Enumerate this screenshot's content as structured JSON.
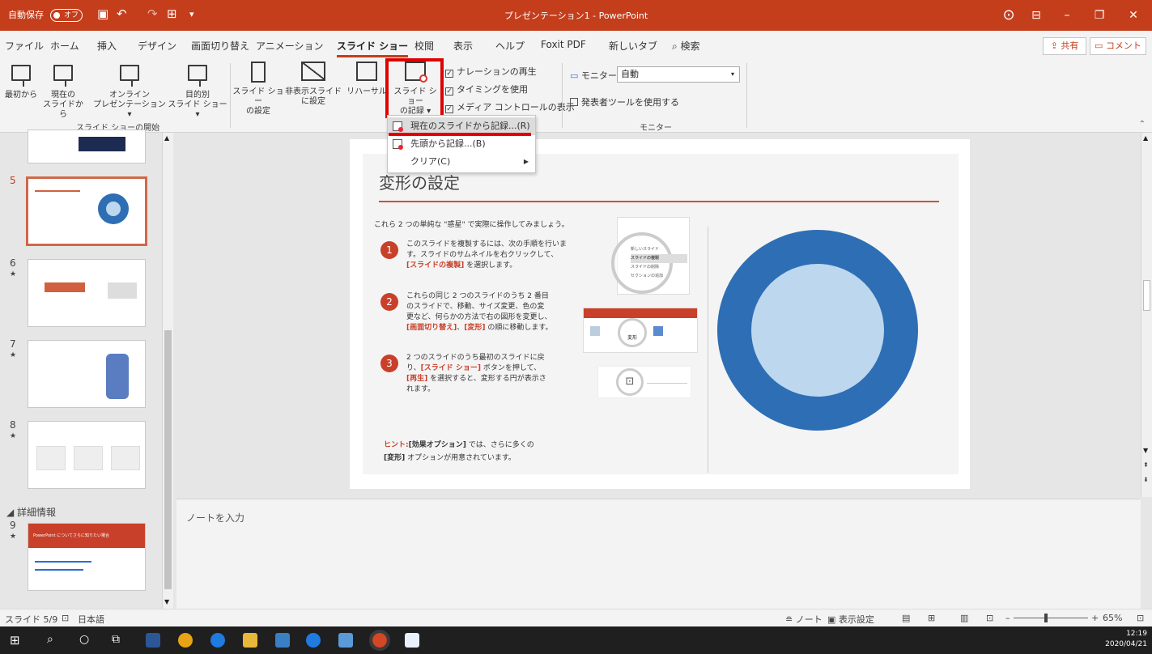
{
  "titlebar": {
    "autosave_label": "自動保存",
    "autosave_state": "オフ",
    "window_title": "プレゼンテーション1 - PowerPoint",
    "bg_color": "#c43e1c"
  },
  "menu": {
    "tabs": [
      "ファイル",
      "ホーム",
      "挿入",
      "デザイン",
      "画面切り替え",
      "アニメーション",
      "スライド ショー",
      "校閲",
      "表示",
      "ヘルプ",
      "Foxit PDF",
      "新しいタブ"
    ],
    "active_tab": "スライド ショー",
    "search": "検索",
    "share": "共有",
    "comment": "コメント"
  },
  "ribbon": {
    "from_start": "最初から",
    "from_current_1": "現在の",
    "from_current_2": "スライドから",
    "online_1": "オンライン",
    "online_2": "プレゼンテーション ▾",
    "custom_1": "目的別",
    "custom_2": "スライド ショー ▾",
    "group_start": "スライド ショーの開始",
    "setup_1": "スライド ショー",
    "setup_2": "の設定",
    "hide_1": "非表示スライド",
    "hide_2": "に設定",
    "rehearse": "リハーサル",
    "record_1": "スライド ショー",
    "record_2": "の記録 ▾",
    "play_narration": "ナレーションの再生",
    "use_timings": "タイミングを使用",
    "media_controls": "メディア コントロールの表示",
    "monitor_label": "モニター:",
    "monitor_value": "自動",
    "presenter_view": "発表者ツールを使用する",
    "group_monitor": "モニター"
  },
  "dropdown": {
    "items": [
      "現在のスライドから記録...(R)",
      "先頭から記録...(B)",
      "クリア(C)"
    ]
  },
  "thumbnails": {
    "numbers": [
      "5",
      "6",
      "7",
      "8",
      "9"
    ],
    "star": "★",
    "section": "詳細情報",
    "slide9_title": "PowerPoint についてさらに知りたい場合"
  },
  "slide": {
    "title": "変形の設定",
    "intro": "これら 2 つの単純な \"惑星\" で実際に操作してみましょう。",
    "step1_a": "このスライドを複製するには、次の手順を行いま",
    "step1_b": "す。スライドのサムネイルを右クリックして、",
    "step1_c_hi": "[スライドの複製]",
    "step1_c": " を選択します。",
    "step2_a": "これらの同じ 2 つのスライドのうち 2 番目",
    "step2_b": "のスライドで、移動、サイズ変更、色の変",
    "step2_c": "更など、何らかの方法で右の図形を変更し、",
    "step2_d_hi1": "[画面切り替え]",
    "step2_d_mid": "、",
    "step2_d_hi2": "[変形]",
    "step2_d": " の順に移動します。",
    "step3_a": "2 つのスライドのうち最初のスライドに戻",
    "step3_b1": "り、",
    "step3_b_hi": "[スライド ショー]",
    "step3_b2": " ボタンを押して、",
    "step3_c_hi": "[再生]",
    "step3_c": " を選択すると、変形する円が表示さ",
    "step3_d": "れます。",
    "hint_label": "ヒント:",
    "hint_hi": "[効果オプション]",
    "hint_a": " では、さらに多くの",
    "hint_b_hi": "[変形]",
    "hint_b": " オプションが用意されています。",
    "mock1_items": [
      "新しいスライド",
      "スライドの複製",
      "スライドの削除",
      "セクションの追加"
    ],
    "mock2_label": "変形",
    "ring_outer_color": "#2e6eb5",
    "ring_inner_color": "#bdd7ee"
  },
  "notes": {
    "placeholder": "ノートを入力"
  },
  "status": {
    "slide_info": "スライド 5/9",
    "language": "日本語",
    "notes_btn": "ノート",
    "display_settings": "表示設定",
    "zoom": "65%"
  },
  "taskbar": {
    "time": "12:19",
    "date": "2020/04/21"
  }
}
